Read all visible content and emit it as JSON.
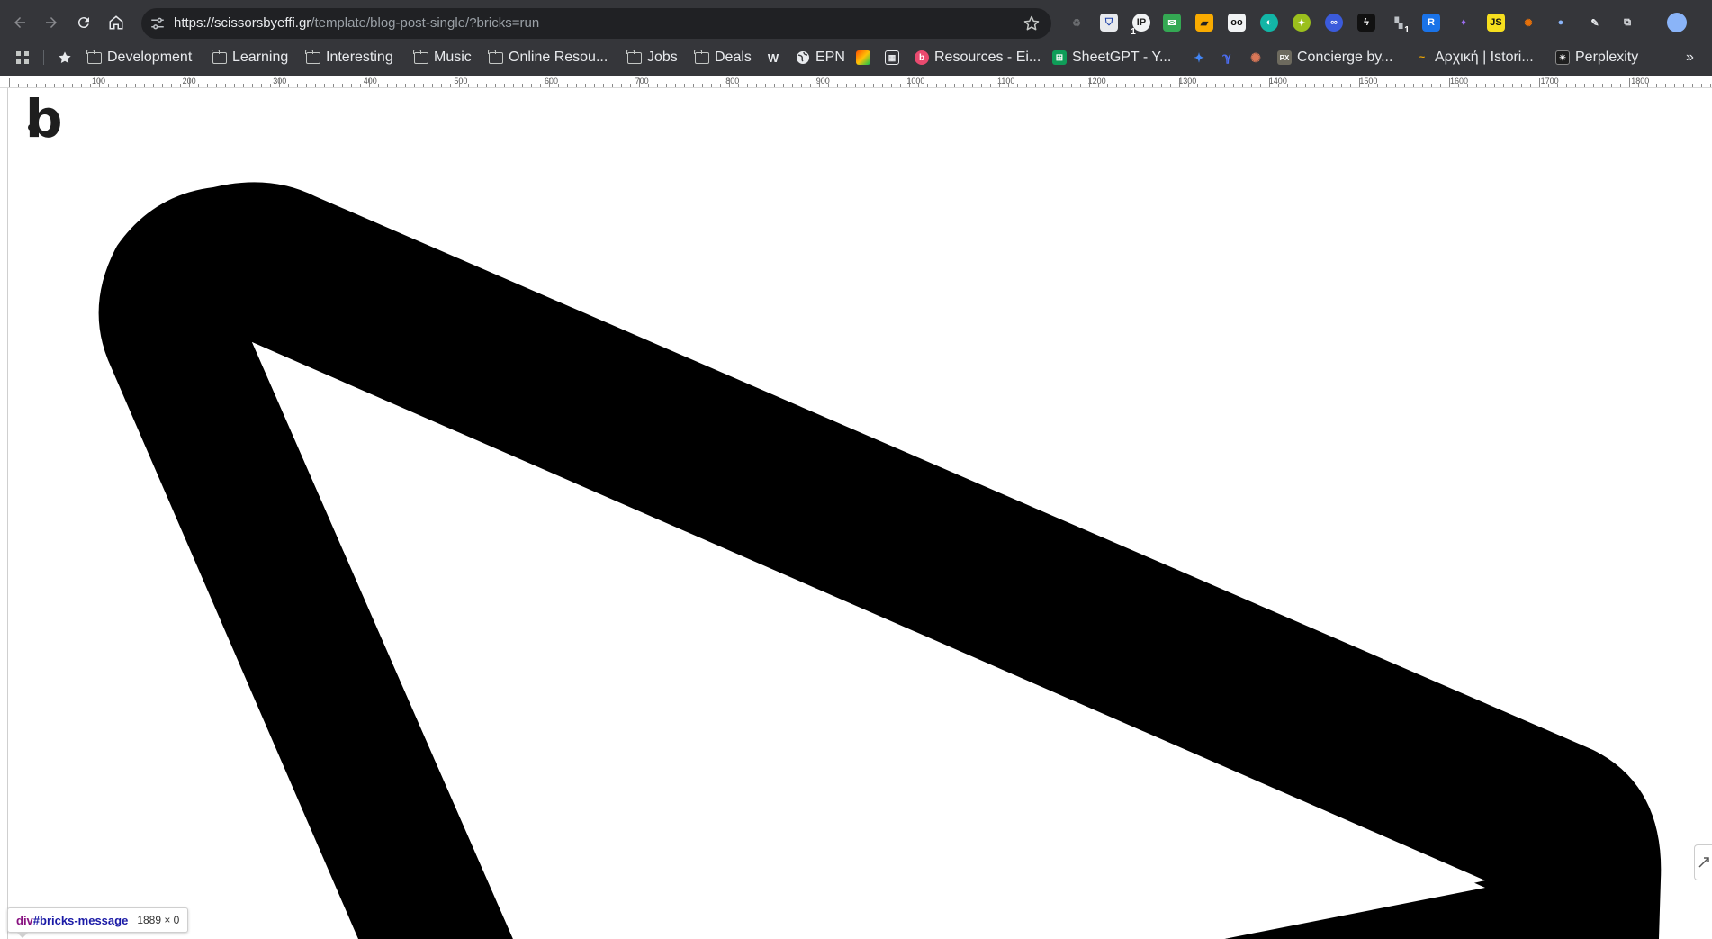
{
  "browser": {
    "url_domain": "https://scissorsbyeffi.gr",
    "url_path": "/template/blog-post-single/?bricks=run",
    "bookmarks": [
      {
        "label": "Development",
        "icon": "folder-icon"
      },
      {
        "label": "Learning",
        "icon": "folder-icon"
      },
      {
        "label": "Interesting",
        "icon": "folder-icon"
      },
      {
        "label": "Music",
        "icon": "folder-icon"
      },
      {
        "label": "Online Resou...",
        "icon": "folder-icon"
      },
      {
        "label": "Jobs",
        "icon": "folder-icon"
      },
      {
        "label": "Deals",
        "icon": "folder-icon"
      },
      {
        "label": "EPN",
        "icon": "globe-icon"
      },
      {
        "label": "Resources - Ei...",
        "icon": "pink-favicon"
      },
      {
        "label": "SheetGPT - Y...",
        "icon": "sheets-favicon"
      },
      {
        "label": "Concierge by...",
        "icon": "concierge-favicon"
      },
      {
        "label": "Αρχική | Istori...",
        "icon": "istoria-favicon"
      },
      {
        "label": "Perplexity",
        "icon": "perplexity-favicon"
      }
    ],
    "extension_badges": {
      "first": "1",
      "second": "1"
    }
  },
  "ruler": {
    "labels": [
      "100",
      "200",
      "300",
      "400",
      "500",
      "600",
      "700",
      "800",
      "900",
      "1000",
      "1100",
      "1200",
      "1300",
      "1400",
      "1500",
      "1600",
      "1700",
      "1800"
    ]
  },
  "page": {
    "logo_text": "b"
  },
  "inspector_tooltip": {
    "selector_tag": "div",
    "selector_id": "#bricks-message",
    "dimensions": "1889 × 0"
  },
  "colors": {
    "chrome_bg": "#35363a",
    "omnibox_bg": "#202124",
    "artwork": "#000000"
  }
}
